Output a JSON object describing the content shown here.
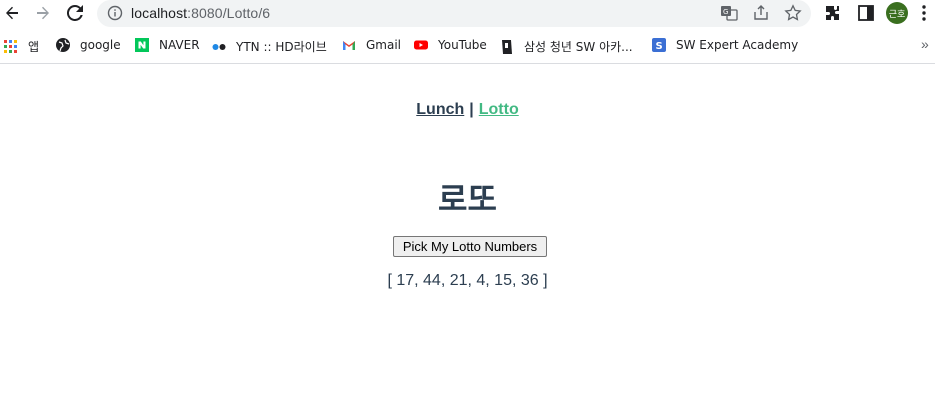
{
  "browser": {
    "url_host": "localhost",
    "url_path": ":8080/Lotto/6",
    "profile_initials": "근호"
  },
  "bookmarks": [
    {
      "label": "앱",
      "icon": "apps-grid-icon"
    },
    {
      "label": "google",
      "icon": "globe-icon"
    },
    {
      "label": "NAVER",
      "icon": "naver-icon"
    },
    {
      "label": "YTN :: HD라이브",
      "icon": "ytn-icon"
    },
    {
      "label": "Gmail",
      "icon": "gmail-icon"
    },
    {
      "label": "YouTube",
      "icon": "youtube-icon"
    },
    {
      "label": "삼성 청년 SW 아카...",
      "icon": "ssafy-icon"
    },
    {
      "label": "SW Expert Academy",
      "icon": "swea-icon"
    }
  ],
  "nav": {
    "lunch": "Lunch",
    "separator": "|",
    "lotto": "Lotto"
  },
  "heading": "로또",
  "button_label": "Pick My Lotto Numbers",
  "result_text": "[ 17, 44, 21, 4, 15, 36 ]",
  "colors": {
    "text": "#2c3e50",
    "active_link": "#42b983"
  }
}
